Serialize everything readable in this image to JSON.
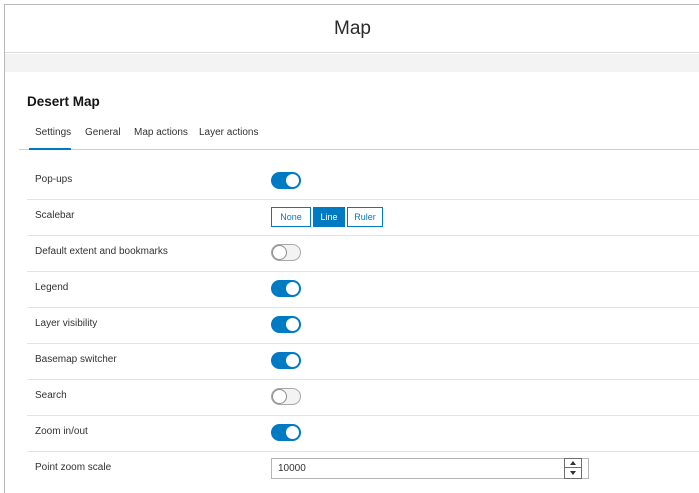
{
  "window": {
    "title": "Map"
  },
  "panel": {
    "heading": "Desert Map"
  },
  "tabs": [
    {
      "label": "Settings",
      "active": true
    },
    {
      "label": "General",
      "active": false
    },
    {
      "label": "Map actions",
      "active": false
    },
    {
      "label": "Layer actions",
      "active": false
    }
  ],
  "settings": {
    "popups": {
      "label": "Pop-ups",
      "enabled": true
    },
    "scalebar": {
      "label": "Scalebar",
      "options": [
        "None",
        "Line",
        "Ruler"
      ],
      "selected": "Line"
    },
    "extent": {
      "label": "Default extent and bookmarks",
      "enabled": false
    },
    "legend": {
      "label": "Legend",
      "enabled": true
    },
    "layer_visibility": {
      "label": "Layer visibility",
      "enabled": true
    },
    "basemap_switcher": {
      "label": "Basemap switcher",
      "enabled": true
    },
    "search": {
      "label": "Search",
      "enabled": false
    },
    "zoom": {
      "label": "Zoom in/out",
      "enabled": true
    },
    "point_zoom_scale": {
      "label": "Point zoom scale",
      "value": "10000"
    }
  },
  "colors": {
    "accent": "#007ac2",
    "toggle_off": "#f3f3f3",
    "divider": "#e4e4e4"
  },
  "icons": {
    "spinner_up": "chevron-up-icon",
    "spinner_down": "chevron-down-icon"
  }
}
